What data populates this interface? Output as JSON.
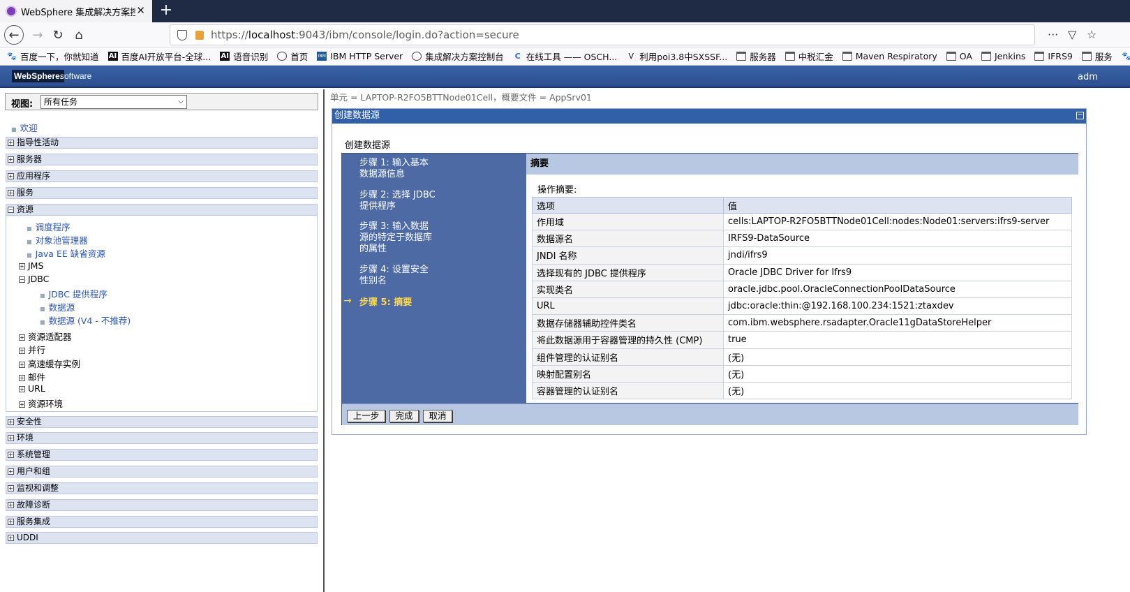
{
  "browser": {
    "tab_title": "WebSphere 集成解决方案控制",
    "new_tab": "+",
    "url_prefix": "https://",
    "url_host": "localhost",
    "url_rest": ":9043/ibm/console/login.do?action=secure",
    "bookmarks": [
      {
        "label": "百度一下，你就知道",
        "icon": "paw-icon"
      },
      {
        "label": "百度AI开放平台-全球...",
        "icon": "ai-icon"
      },
      {
        "label": "语音识别",
        "icon": "ai-icon"
      },
      {
        "label": "首页",
        "icon": "globe-icon"
      },
      {
        "label": "IBM HTTP Server",
        "icon": "ibm-icon"
      },
      {
        "label": "集成解决方案控制台",
        "icon": "globe-icon"
      },
      {
        "label": "在线工具 —— OSCH...",
        "icon": "c-icon"
      },
      {
        "label": "利用poi3.8中SXSSF...",
        "icon": "v-icon"
      },
      {
        "label": "服务器",
        "icon": "folder-icon"
      },
      {
        "label": "中税汇金",
        "icon": "folder-icon"
      },
      {
        "label": "Maven Respiratory",
        "icon": "folder-icon"
      },
      {
        "label": "OA",
        "icon": "folder-icon"
      },
      {
        "label": "Jenkins",
        "icon": "folder-icon"
      },
      {
        "label": "IFRS9",
        "icon": "folder-icon"
      },
      {
        "label": "服务",
        "icon": "folder-icon"
      },
      {
        "label": "百度",
        "icon": "paw-icon"
      }
    ]
  },
  "header": {
    "logo": "WebSphere.",
    "software": "software",
    "user": "adm"
  },
  "sidebar": {
    "view_label": "视图:",
    "view_value": "所有任务",
    "welcome": "欢迎",
    "top_items": [
      "指导性活动",
      "服务器",
      "应用程序",
      "服务",
      "资源"
    ],
    "resources": {
      "links": [
        "调度程序",
        "对象池管理器",
        "Java EE 缺省资源"
      ],
      "jms": "JMS",
      "jdbc": "JDBC",
      "jdbc_links": [
        "JDBC 提供程序",
        "数据源",
        "数据源 (V4 - 不推荐)"
      ],
      "more": [
        "资源适配器",
        "并行",
        "高速缓存实例",
        "邮件",
        "URL",
        "资源环境"
      ]
    },
    "bottom_items": [
      "安全性",
      "环境",
      "系统管理",
      "用户和组",
      "监视和调整",
      "故障诊断",
      "服务集成",
      "UDDI"
    ]
  },
  "main": {
    "scope": "单元 = LAPTOP-R2FO5BTTNode01Cell，概要文件 = AppSrv01",
    "panel_title": "创建数据源",
    "form_title": "创建数据源",
    "steps": [
      {
        "line1": "步骤 1: 输入基本",
        "line2": "数据源信息",
        "line3": ""
      },
      {
        "line1": "步骤 2: 选择 JDBC",
        "line2": "提供程序",
        "line3": ""
      },
      {
        "line1": "步骤 3: 输入数据",
        "line2": "源的特定于数据库",
        "line3": "的属性"
      },
      {
        "line1": "步骤 4: 设置安全",
        "line2": "性别名",
        "line3": ""
      },
      {
        "line1": "步骤 5: 摘要",
        "line2": "",
        "line3": ""
      }
    ],
    "current_arrow": "→",
    "summary_header": "摘要",
    "summary_label": "操作摘要:",
    "table_headers": [
      "选项",
      "值"
    ],
    "rows": [
      [
        "作用域",
        "cells:LAPTOP-R2FO5BTTNode01Cell:nodes:Node01:servers:ifrs9-server"
      ],
      [
        "数据源名",
        "IRFS9-DataSource"
      ],
      [
        "JNDI 名称",
        "jndi/ifrs9"
      ],
      [
        "选择现有的 JDBC 提供程序",
        "Oracle JDBC Driver for Ifrs9"
      ],
      [
        "实现类名",
        "oracle.jdbc.pool.OracleConnectionPoolDataSource"
      ],
      [
        "URL",
        "jdbc:oracle:thin:@192.168.100.234:1521:ztaxdev"
      ],
      [
        "数据存储器辅助控件类名",
        "com.ibm.websphere.rsadapter.Oracle11gDataStoreHelper"
      ],
      [
        "将此数据源用于容器管理的持久性 (CMP)",
        "true"
      ],
      [
        "组件管理的认证别名",
        "(无)"
      ],
      [
        "映射配置别名",
        "(无)"
      ],
      [
        "容器管理的认证别名",
        "(无)"
      ]
    ],
    "buttons": {
      "prev": "上一步",
      "finish": "完成",
      "cancel": "取消"
    }
  }
}
